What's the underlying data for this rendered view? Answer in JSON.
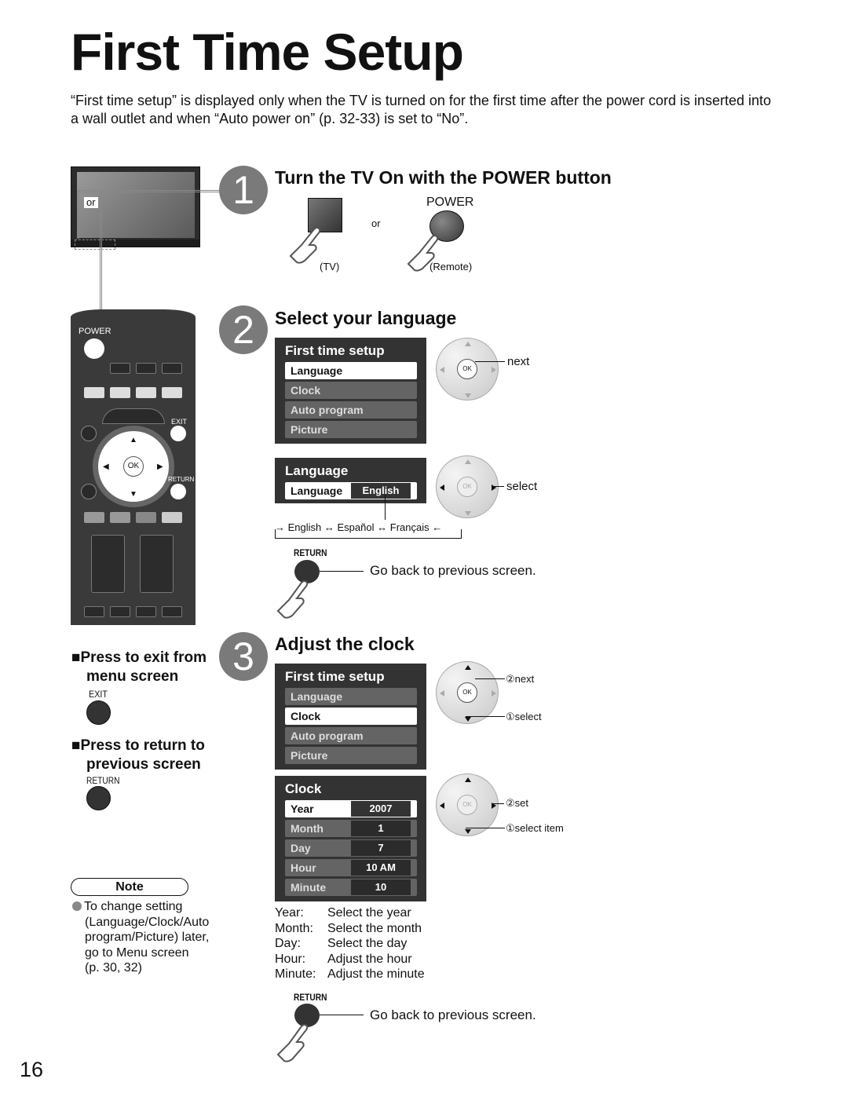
{
  "page": {
    "title": "First Time Setup",
    "intro": "“First time setup” is displayed only when the TV is turned on for the first time after the power cord is inserted into a wall outlet and when “Auto power on” (p. 32-33) is set to “No”.",
    "page_number": "16"
  },
  "tv_illustration": {
    "or_label": "or"
  },
  "remote": {
    "power_label": "POWER",
    "exit_label": "EXIT",
    "return_label": "RETURN",
    "ok_label": "OK"
  },
  "step1": {
    "number": "1",
    "title": "Turn the TV On with the POWER button",
    "power_label": "POWER",
    "or_label": "or",
    "tv_caption": "(TV)",
    "remote_caption": "(Remote)"
  },
  "step2": {
    "number": "2",
    "title": "Select your language",
    "menu": {
      "title": "First time setup",
      "items": [
        {
          "label": "Language",
          "selected": true
        },
        {
          "label": "Clock",
          "selected": false
        },
        {
          "label": "Auto program",
          "selected": false
        },
        {
          "label": "Picture",
          "selected": false
        }
      ]
    },
    "menu_action": "next",
    "language_panel": {
      "title": "Language",
      "row_label": "Language",
      "value": "English"
    },
    "language_action": "select",
    "cycle": [
      "English",
      "Español",
      "Français"
    ],
    "cycle_arrow": "↔",
    "return_label": "RETURN",
    "return_text": "Go back to previous screen."
  },
  "step3": {
    "number": "3",
    "title": "Adjust the clock",
    "menu": {
      "title": "First time setup",
      "items": [
        {
          "label": "Language",
          "selected": false
        },
        {
          "label": "Clock",
          "selected": true
        },
        {
          "label": "Auto program",
          "selected": false
        },
        {
          "label": "Picture",
          "selected": false
        }
      ]
    },
    "menu_actions": {
      "next": "②next",
      "select": "①select"
    },
    "clock_panel": {
      "title": "Clock",
      "rows": [
        {
          "label": "Year",
          "value": "2007",
          "selected": true
        },
        {
          "label": "Month",
          "value": "1",
          "selected": false
        },
        {
          "label": "Day",
          "value": "7",
          "selected": false
        },
        {
          "label": "Hour",
          "value": "10 AM",
          "selected": false
        },
        {
          "label": "Minute",
          "value": "10",
          "selected": false
        }
      ]
    },
    "clock_actions": {
      "set": "②set",
      "select_item": "①select item"
    },
    "descriptions": [
      {
        "term": "Year:",
        "text": "Select the year"
      },
      {
        "term": "Month:",
        "text": "Select the month"
      },
      {
        "term": "Day:",
        "text": "Select the day"
      },
      {
        "term": "Hour:",
        "text": "Adjust the hour"
      },
      {
        "term": "Minute:",
        "text": "Adjust the minute"
      }
    ],
    "return_label": "RETURN",
    "return_text": "Go back to previous screen."
  },
  "sidebar": {
    "exit_heading_line1": "Press to exit from",
    "exit_heading_line2": "menu screen",
    "exit_label": "EXIT",
    "return_heading_line1": "Press to return to",
    "return_heading_line2": "previous screen",
    "return_label": "RETURN",
    "note_title": "Note",
    "note_lines": [
      "To change setting",
      "(Language/Clock/Auto",
      "program/Picture) later,",
      "go to Menu screen",
      "(p. 30, 32)"
    ]
  }
}
